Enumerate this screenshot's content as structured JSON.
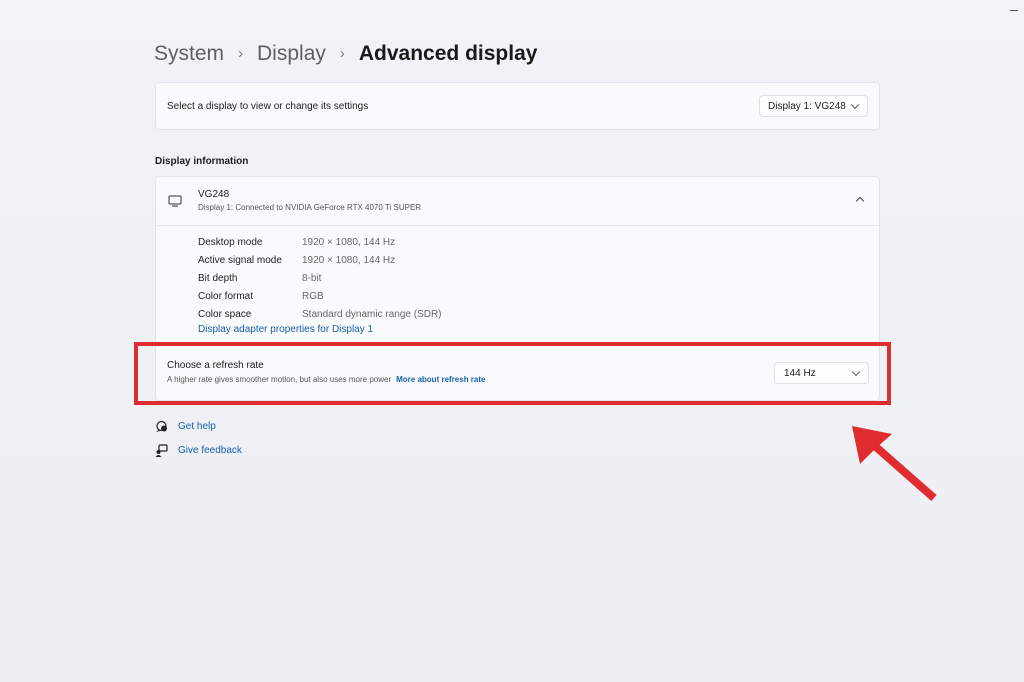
{
  "breadcrumb": {
    "items": [
      "System",
      "Display"
    ],
    "current": "Advanced display",
    "separator": "›"
  },
  "select_display": {
    "label": "Select a display to view or change its settings",
    "value": "Display 1: VG248"
  },
  "display_info": {
    "section_title": "Display information",
    "name": "VG248",
    "subtitle": "Display 1: Connected to NVIDIA GeForce RTX 4070 Ti SUPER",
    "rows": [
      {
        "key": "Desktop mode",
        "value": "1920 × 1080, 144 Hz"
      },
      {
        "key": "Active signal mode",
        "value": "1920 × 1080, 144 Hz"
      },
      {
        "key": "Bit depth",
        "value": "8-bit"
      },
      {
        "key": "Color format",
        "value": "RGB"
      },
      {
        "key": "Color space",
        "value": "Standard dynamic range (SDR)"
      }
    ],
    "adapter_link": "Display adapter properties for Display 1"
  },
  "refresh_rate": {
    "title": "Choose a refresh rate",
    "description": "A higher rate gives smoother motion, but also uses more power",
    "link": "More about refresh rate",
    "value": "144 Hz"
  },
  "footer_links": {
    "get_help": "Get help",
    "give_feedback": "Give feedback"
  },
  "icons": {
    "monitor": "monitor-icon",
    "help": "help-icon",
    "feedback": "feedback-icon",
    "chevron_down": "chevron-down-icon",
    "chevron_up": "chevron-up-icon"
  },
  "colors": {
    "background": "#eef1f6",
    "card": "#f9fafc",
    "link": "#1a5fa8",
    "annotation_red": "#e02b2f"
  }
}
